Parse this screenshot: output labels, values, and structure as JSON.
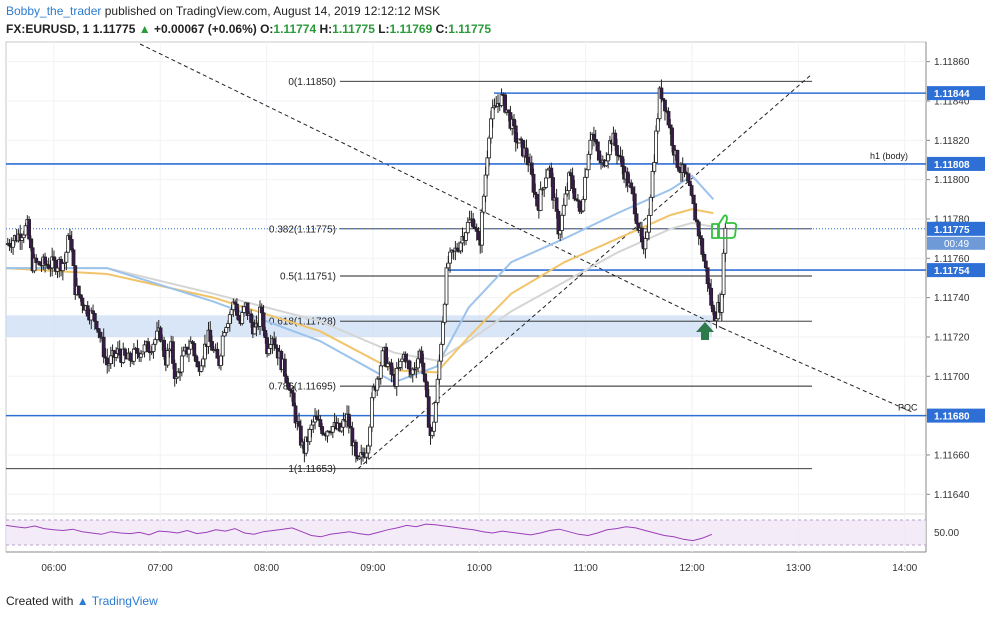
{
  "header": {
    "user": "Bobby_the_trader",
    "published": "published on TradingView.com, August 14, 2019 12:12:12 MSK",
    "symbol": "FX:EURUSD, 1",
    "last": "1.11775",
    "arrow": "▲",
    "change": "+0.00067 (+0.06%)",
    "o_label": "O:",
    "o_value": "1.11774",
    "h_label": "H:",
    "h_value": "1.11775",
    "l_label": "L:",
    "l_value": "1.11769",
    "c_label": "C:",
    "c_value": "1.11775"
  },
  "footer": {
    "created_with": "Created with",
    "brand": "TradingView"
  },
  "colors": {
    "up": "#ffffff",
    "down": "#3a1a4f",
    "level_line": "#2e6fd6",
    "ema_blue": "#9cc3ec",
    "ema_orange": "#f2c46a",
    "ema_gray": "#d5d5d5",
    "rsi": "#9b3fb8",
    "rsi_band": "#efe3f7",
    "support_zone": "#c9dcf3",
    "arrow": "#2f7a4a",
    "thumb": "#31c23a"
  },
  "chart_data": {
    "type": "candlestick",
    "symbol": "EURUSD",
    "timeframe": "1",
    "ylim": [
      1.11632,
      1.1187
    ],
    "y_ticks": [
      "1.11860",
      "1.11840",
      "1.11820",
      "1.11800",
      "1.11780",
      "1.11760",
      "1.11740",
      "1.11720",
      "1.11700",
      "1.11680",
      "1.11660",
      "1.11640"
    ],
    "x_ticks": [
      "06:00",
      "07:00",
      "08:00",
      "09:00",
      "10:00",
      "11:00",
      "12:00",
      "13:00",
      "14:00"
    ],
    "x_range_hours": [
      5.55,
      14.2
    ],
    "price_series": [
      [
        5.55,
        1.11767
      ],
      [
        5.65,
        1.11771
      ],
      [
        5.75,
        1.11776
      ],
      [
        5.8,
        1.11757
      ],
      [
        5.9,
        1.11757
      ],
      [
        6.0,
        1.11757
      ],
      [
        6.1,
        1.11758
      ],
      [
        6.15,
        1.11773
      ],
      [
        6.2,
        1.11745
      ],
      [
        6.3,
        1.11735
      ],
      [
        6.4,
        1.11728
      ],
      [
        6.5,
        1.11706
      ],
      [
        6.6,
        1.11712
      ],
      [
        6.7,
        1.11708
      ],
      [
        6.8,
        1.11713
      ],
      [
        6.9,
        1.11715
      ],
      [
        7.0,
        1.11722
      ],
      [
        7.05,
        1.11708
      ],
      [
        7.1,
        1.11715
      ],
      [
        7.15,
        1.11697
      ],
      [
        7.2,
        1.11708
      ],
      [
        7.3,
        1.11718
      ],
      [
        7.35,
        1.11703
      ],
      [
        7.45,
        1.1172
      ],
      [
        7.55,
        1.11706
      ],
      [
        7.6,
        1.11725
      ],
      [
        7.7,
        1.11738
      ],
      [
        7.75,
        1.11726
      ],
      [
        7.8,
        1.11736
      ],
      [
        7.85,
        1.11728
      ],
      [
        7.9,
        1.11722
      ],
      [
        7.95,
        1.11735
      ],
      [
        8.0,
        1.11714
      ],
      [
        8.05,
        1.11722
      ],
      [
        8.1,
        1.11713
      ],
      [
        8.2,
        1.11698
      ],
      [
        8.3,
        1.11672
      ],
      [
        8.35,
        1.11662
      ],
      [
        8.45,
        1.11678
      ],
      [
        8.55,
        1.11672
      ],
      [
        8.6,
        1.11675
      ],
      [
        8.7,
        1.11672
      ],
      [
        8.75,
        1.1168
      ],
      [
        8.8,
        1.1167
      ],
      [
        8.85,
        1.11654
      ],
      [
        8.95,
        1.11665
      ],
      [
        9.0,
        1.11691
      ],
      [
        9.1,
        1.11712
      ],
      [
        9.2,
        1.11697
      ],
      [
        9.3,
        1.11712
      ],
      [
        9.35,
        1.117
      ],
      [
        9.45,
        1.11713
      ],
      [
        9.55,
        1.11666
      ],
      [
        9.6,
        1.11691
      ],
      [
        9.7,
        1.11757
      ],
      [
        9.8,
        1.11766
      ],
      [
        9.9,
        1.11778
      ],
      [
        9.95,
        1.1178
      ],
      [
        10.0,
        1.11764
      ],
      [
        10.1,
        1.1183
      ],
      [
        10.2,
        1.11842
      ],
      [
        10.25,
        1.11837
      ],
      [
        10.35,
        1.1182
      ],
      [
        10.45,
        1.11812
      ],
      [
        10.55,
        1.11786
      ],
      [
        10.65,
        1.11808
      ],
      [
        10.75,
        1.11773
      ],
      [
        10.85,
        1.11802
      ],
      [
        10.95,
        1.11782
      ],
      [
        11.05,
        1.11825
      ],
      [
        11.15,
        1.11806
      ],
      [
        11.25,
        1.11822
      ],
      [
        11.35,
        1.11806
      ],
      [
        11.45,
        1.1179
      ],
      [
        11.55,
        1.1176
      ],
      [
        11.65,
        1.11815
      ],
      [
        11.7,
        1.11846
      ],
      [
        11.75,
        1.11838
      ],
      [
        11.85,
        1.1181
      ],
      [
        11.95,
        1.118
      ],
      [
        12.05,
        1.11777
      ],
      [
        12.15,
        1.11748
      ],
      [
        12.2,
        1.1173
      ],
      [
        12.28,
        1.11738
      ],
      [
        12.3,
        1.11772
      ],
      [
        12.32,
        1.11775
      ]
    ],
    "ema_blue": [
      [
        5.55,
        1.11755
      ],
      [
        6.5,
        1.11755
      ],
      [
        7.5,
        1.11738
      ],
      [
        8.5,
        1.11718
      ],
      [
        9.2,
        1.11697
      ],
      [
        9.6,
        1.11705
      ],
      [
        9.9,
        1.11735
      ],
      [
        10.3,
        1.11758
      ],
      [
        10.8,
        1.1177
      ],
      [
        11.3,
        1.11783
      ],
      [
        11.8,
        1.11795
      ],
      [
        12.0,
        1.11802
      ],
      [
        12.2,
        1.1179
      ]
    ],
    "ema_orange": [
      [
        5.55,
        1.11755
      ],
      [
        6.5,
        1.11752
      ],
      [
        7.5,
        1.1174
      ],
      [
        8.5,
        1.11723
      ],
      [
        9.2,
        1.11703
      ],
      [
        9.6,
        1.11702
      ],
      [
        9.9,
        1.1172
      ],
      [
        10.3,
        1.11742
      ],
      [
        10.8,
        1.11758
      ],
      [
        11.3,
        1.1177
      ],
      [
        11.8,
        1.11782
      ],
      [
        12.0,
        1.11785
      ],
      [
        12.2,
        1.11783
      ]
    ],
    "ema_gray": [
      [
        5.55,
        1.11755
      ],
      [
        6.5,
        1.11755
      ],
      [
        7.5,
        1.11742
      ],
      [
        8.5,
        1.11728
      ],
      [
        9.2,
        1.11712
      ],
      [
        9.6,
        1.11708
      ],
      [
        9.9,
        1.11718
      ],
      [
        10.3,
        1.11733
      ],
      [
        10.8,
        1.11748
      ],
      [
        11.3,
        1.11763
      ],
      [
        11.8,
        1.11775
      ],
      [
        12.0,
        1.11778
      ],
      [
        12.2,
        1.11776
      ]
    ],
    "fib_levels": [
      {
        "label": "0(1.11850)",
        "value": 1.1185
      },
      {
        "label": "0.382(1.11775)",
        "value": 1.11775
      },
      {
        "label": "0.5(1.11751)",
        "value": 1.11751
      },
      {
        "label": "0.618(1.11728)",
        "value": 1.11728
      },
      {
        "label": "0.786(1.11695)",
        "value": 1.11695
      },
      {
        "label": "1(1.11653)",
        "value": 1.11653
      }
    ],
    "horizontal_levels": [
      {
        "label": "1.11844",
        "value": 1.11844
      },
      {
        "label": "1.11808",
        "value": 1.11808,
        "note": "h1 (body)"
      },
      {
        "label": "1.11754",
        "value": 1.11754
      },
      {
        "label": "1.11680",
        "value": 1.1168,
        "note": "POC"
      }
    ],
    "current_price_label": "1.11775",
    "countdown_label": "00:49",
    "support_zone": [
      1.1172,
      1.11731
    ],
    "rsi": {
      "level_label": "50.00",
      "values": [
        62,
        60,
        58,
        61,
        57,
        55,
        54,
        56,
        52,
        50,
        48,
        52,
        50,
        49,
        51,
        47,
        53,
        52,
        50,
        54,
        49,
        51,
        55,
        53,
        57,
        50,
        48,
        52,
        54,
        56,
        58,
        52,
        46,
        44,
        48,
        50,
        52,
        49,
        47,
        51,
        55,
        58,
        62,
        60,
        64,
        63,
        61,
        59,
        57,
        55,
        52,
        50,
        53,
        51,
        49,
        47,
        50,
        54,
        56,
        52,
        48,
        46,
        50,
        55,
        57,
        60,
        58,
        54,
        50,
        46,
        44,
        40,
        38,
        42,
        48
      ]
    }
  }
}
